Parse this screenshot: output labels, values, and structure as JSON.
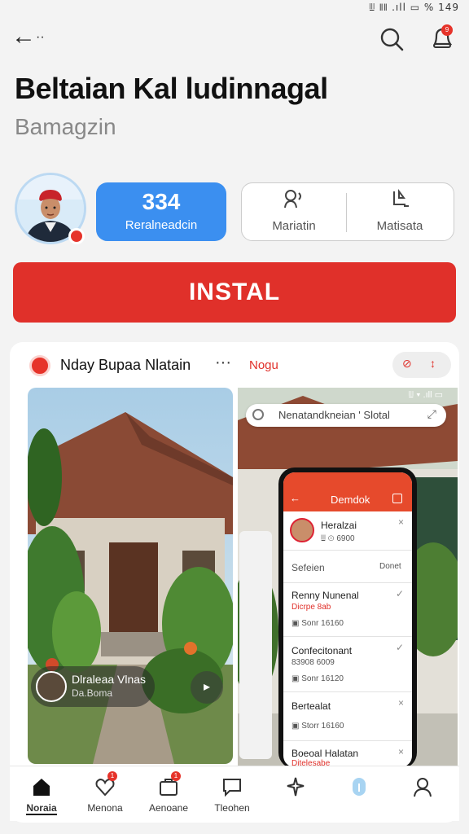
{
  "status_bar": {
    "text": "ꔗ 𝍪𝍪 .ıll ▭ % 149"
  },
  "top_bar": {
    "back": "←",
    "back_dots": "··",
    "search_icon": "search-icon",
    "bell_icon": "bell-icon",
    "bell_badge": "9"
  },
  "app": {
    "title": "Beltaian Kal ludinnagal",
    "subtitle": "Bamagzin"
  },
  "rating": {
    "value": "334",
    "label": "Reralneadcin"
  },
  "stats": [
    {
      "icon": "person-voice-icon",
      "label": "Mariatin"
    },
    {
      "icon": "download-icon",
      "label": "Matisata"
    }
  ],
  "install": {
    "label": "INSTAL"
  },
  "gallery": {
    "left": {
      "title": "Nday Bupaa Nlatain",
      "more": "···",
      "chip_name": "Dlraleaa Vlnas",
      "chip_sub": "Da.Boma",
      "play": "▸"
    },
    "right": {
      "label": "Nogu",
      "pill_icon_1": "⊘",
      "pill_icon_2": "↕",
      "search_text": "Nenatandkneian ' Slotal",
      "phone": {
        "header": "Demdok",
        "rows": [
          {
            "title": "Heralzai",
            "meta": "ꔗ ⊙ 6900"
          },
          {
            "title": "Sefeien",
            "meta": "Donet"
          },
          {
            "title": "Renny Nunenal",
            "red": "Dicrpe 8ab",
            "meta": "▣ Sonr 16160"
          },
          {
            "title": "Confecitonant",
            "red": "83908 6009",
            "meta": "▣ Sonr 16120"
          },
          {
            "title": "Bertealat",
            "meta": "▣ Storr 16160"
          },
          {
            "title": "Boeoal Halatan",
            "red": "Ditelesabe"
          }
        ]
      }
    }
  },
  "nav": [
    {
      "label": "Noraia",
      "icon": "home-icon",
      "active": true
    },
    {
      "label": "Menona",
      "icon": "heart-icon",
      "badge": "1"
    },
    {
      "label": "Aenoane",
      "icon": "briefcase-icon",
      "badge": "1"
    },
    {
      "label": "Tleohen",
      "icon": "chat-icon"
    },
    {
      "label": "",
      "icon": "sparkle-icon"
    },
    {
      "label": "",
      "icon": "info-icon"
    },
    {
      "label": "",
      "icon": "profile-icon"
    }
  ],
  "colors": {
    "accent": "#e0302a",
    "blue": "#3b8ff0"
  }
}
